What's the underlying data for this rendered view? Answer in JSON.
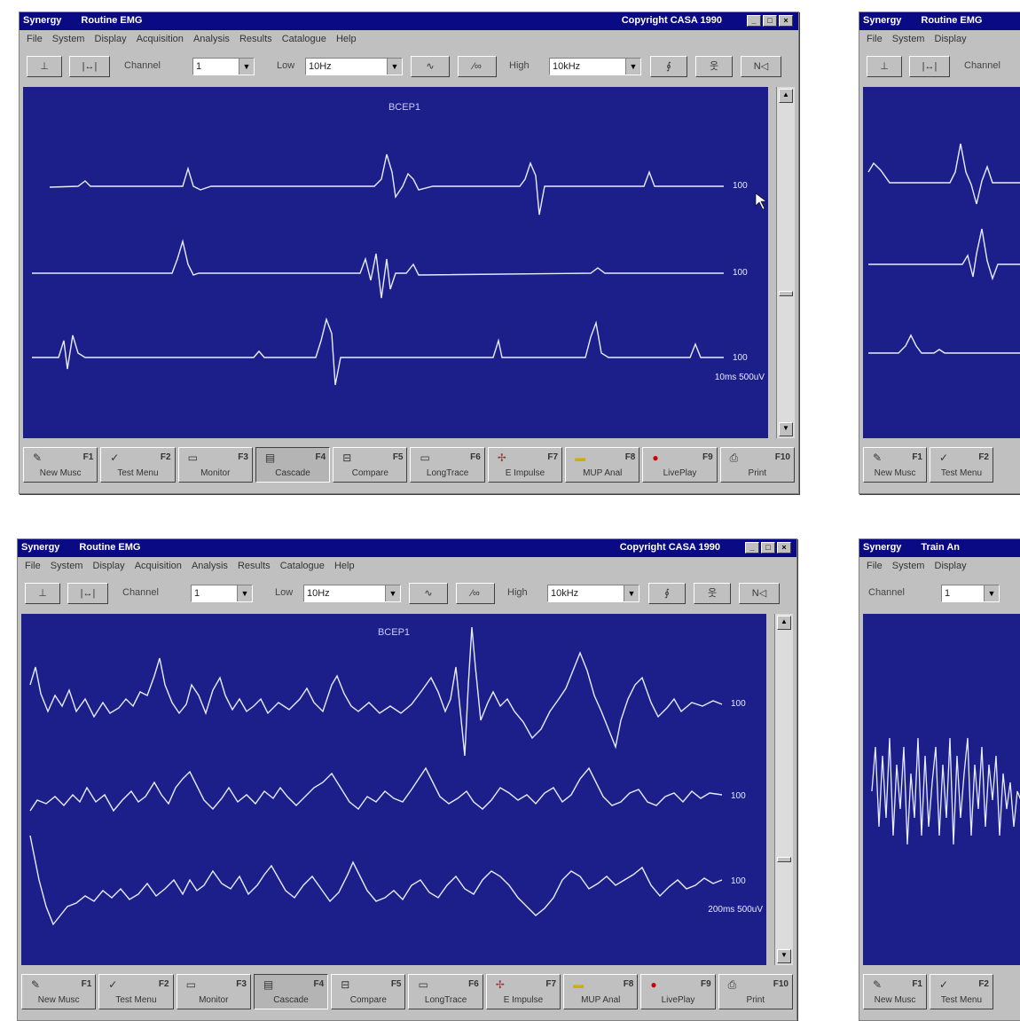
{
  "colors": {
    "title_bar": "#0a0a84",
    "plot_bg": "#1c1f8a",
    "trace": "#e8ecff",
    "chrome": "#c0c0c0"
  },
  "windows": [
    {
      "title": "Synergy",
      "subtitle": "Routine EMG",
      "copyright": "Copyright CASA 1990",
      "menu": [
        "File",
        "System",
        "Display",
        "Acquisition",
        "Analysis",
        "Results",
        "Catalogue",
        "Help"
      ],
      "toolbar": {
        "channel_label": "Channel",
        "channel_value": "1",
        "low_label": "Low",
        "low_value": "10Hz",
        "high_label": "High",
        "high_value": "10kHz"
      },
      "plot": {
        "title": "BCEP1",
        "trace_labels": [
          "100",
          "100",
          "100"
        ],
        "scale_text": "10ms 500uV"
      },
      "fkeys": [
        {
          "key": "F1",
          "label": "New Musc",
          "icon": "muscle-icon"
        },
        {
          "key": "F2",
          "label": "Test Menu",
          "icon": "test-icon"
        },
        {
          "key": "F3",
          "label": "Monitor",
          "icon": "monitor-icon"
        },
        {
          "key": "F4",
          "label": "Cascade",
          "icon": "cascade-icon",
          "pressed": true
        },
        {
          "key": "F5",
          "label": "Compare",
          "icon": "compare-icon"
        },
        {
          "key": "F6",
          "label": "LongTrace",
          "icon": "longtrace-icon"
        },
        {
          "key": "F7",
          "label": "E Impulse",
          "icon": "impulse-icon"
        },
        {
          "key": "F8",
          "label": "MUP Anal",
          "icon": "mup-icon"
        },
        {
          "key": "F9",
          "label": "LivePlay",
          "icon": "live-icon"
        },
        {
          "key": "F10",
          "label": "Print",
          "icon": "print-icon"
        }
      ]
    },
    {
      "title": "Synergy",
      "subtitle": "Routine EMG",
      "copyright": "Copyright CASA 1990",
      "menu": [
        "File",
        "System",
        "Display",
        "Acquisition",
        "Analysis",
        "Results",
        "Catalogue",
        "Help"
      ],
      "toolbar": {
        "channel_label": "Channel",
        "channel_value": "1",
        "low_label": "Low",
        "low_value": "10Hz",
        "high_label": "High",
        "high_value": "10kHz"
      },
      "plot": {
        "title": "BCEP1",
        "trace_labels": [
          "100",
          "100",
          "100"
        ],
        "scale_text": "200ms 500uV"
      },
      "fkeys": [
        {
          "key": "F1",
          "label": "New Musc",
          "icon": "muscle-icon"
        },
        {
          "key": "F2",
          "label": "Test Menu",
          "icon": "test-icon"
        },
        {
          "key": "F3",
          "label": "Monitor",
          "icon": "monitor-icon"
        },
        {
          "key": "F4",
          "label": "Cascade",
          "icon": "cascade-icon",
          "pressed": true
        },
        {
          "key": "F5",
          "label": "Compare",
          "icon": "compare-icon"
        },
        {
          "key": "F6",
          "label": "LongTrace",
          "icon": "longtrace-icon"
        },
        {
          "key": "F7",
          "label": "E Impulse",
          "icon": "impulse-icon"
        },
        {
          "key": "F8",
          "label": "MUP Anal",
          "icon": "mup-icon"
        },
        {
          "key": "F9",
          "label": "LivePlay",
          "icon": "live-icon"
        },
        {
          "key": "F10",
          "label": "Print",
          "icon": "print-icon"
        }
      ]
    },
    {
      "title": "Synergy",
      "subtitle": "Routine EMG",
      "menu": [
        "File",
        "System",
        "Display"
      ],
      "toolbar": {
        "channel_label": "Channel"
      },
      "fkeys": [
        {
          "key": "F1",
          "label": "New Musc",
          "icon": "muscle-icon"
        },
        {
          "key": "F2",
          "label": "Test Menu",
          "icon": "test-icon"
        }
      ]
    },
    {
      "title": "Synergy",
      "subtitle": "Train An",
      "menu": [
        "File",
        "System",
        "Display"
      ],
      "toolbar": {
        "channel_label": "Channel",
        "channel_value": "1"
      },
      "fkeys": [
        {
          "key": "F1",
          "label": "New Musc",
          "icon": "muscle-icon"
        },
        {
          "key": "F2",
          "label": "Test Menu",
          "icon": "test-icon"
        }
      ]
    }
  ]
}
